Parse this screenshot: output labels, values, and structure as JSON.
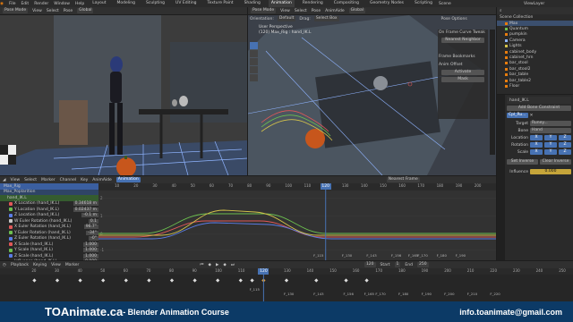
{
  "menu": {
    "items": [
      "File",
      "Edit",
      "Render",
      "Window",
      "Help"
    ],
    "workspaces": [
      "Layout",
      "Modeling",
      "Sculpting",
      "UV Editing",
      "Texture Paint",
      "Shading",
      "Animation",
      "Rendering",
      "Compositing",
      "Geometry Nodes",
      "Scripting"
    ],
    "active_workspace": "Animation",
    "scene": "Scene",
    "view_layer": "ViewLayer"
  },
  "viewport_left": {
    "mode": "Pose Mode",
    "view": "View",
    "select": "Select",
    "pose": "Pose",
    "transform": "Global",
    "orientation_label": "Orientation:",
    "orientation": "Default",
    "drag_label": "Drag:",
    "drag": "Select Box",
    "options": "Pose Options"
  },
  "viewport_right": {
    "mode": "Pose Mode",
    "view": "View",
    "select": "Select",
    "pose": "Pose",
    "animate": "AnimAide",
    "transform": "Global",
    "title": "User Perspective",
    "subtitle": "(120) Max_Rig : hand_IK.L",
    "orientation_label": "Orientation:",
    "orientation": "Default",
    "drag_label": "Drag:",
    "drag": "Select Box",
    "options": "Pose Options",
    "npanel": {
      "frame_curve_tweak": "On Frame Curve Tweak",
      "neighbor": "Nearest Neighbor",
      "frame_bookmarks": "Frame Bookmarks",
      "anim_offset": "Anim Offset",
      "activate": "Activate",
      "mask": "Mask"
    }
  },
  "outliner": {
    "title": "Scene Collection",
    "items": [
      "Max",
      "Quantum",
      "pumpkin",
      "Camera",
      "Lights",
      "cabinet_body",
      "cabinet_hrn",
      "bar_stool",
      "bar_stool2",
      "bar_table",
      "bar_table2",
      "Floor"
    ]
  },
  "properties": {
    "bone": "hand_IK.L",
    "add_constraint": "Add Bone Constraint",
    "constraint": "Cpl_Ru...",
    "target_label": "Target",
    "target": "Runey...",
    "bone_label": "Bone",
    "bone_value": "Hand",
    "fields": [
      {
        "label": "Location",
        "x": "X",
        "y": "Y",
        "z": "Z"
      },
      {
        "label": "Rotation",
        "x": "X",
        "y": "Y",
        "z": "Z"
      },
      {
        "label": "Scale",
        "x": "X",
        "y": "Y",
        "z": "Z"
      }
    ],
    "set_inverse": "Set Inverse",
    "clear_inverse": "Clear Inverse",
    "influence_label": "Influence",
    "influence": "0.000"
  },
  "graph_editor": {
    "header": [
      "View",
      "Select",
      "Marker",
      "Channel",
      "Key",
      "AnimAide"
    ],
    "mode": "Animation",
    "pivot": "Nearest Frame",
    "rig": "Max_Rig",
    "action": "Max_Poplarition",
    "bone": "hand_IK.L",
    "channels": [
      {
        "name": "X Location (hand_IK.L)",
        "value": "0.34618 m",
        "color": "#e05858"
      },
      {
        "name": "Y Location (hand_IK.L)",
        "value": "0.02437 m",
        "color": "#6cbf4f"
      },
      {
        "name": "Z Location (hand_IK.L)",
        "value": "-0.1 m",
        "color": "#5a7de8"
      },
      {
        "name": "W Euler Rotation (hand_IK.L)",
        "value": "0.1",
        "color": "#c8c8c8"
      },
      {
        "name": "X Euler Rotation (hand_IK.L)",
        "value": "96.7°",
        "color": "#e05858"
      },
      {
        "name": "Y Euler Rotation (hand_IK.L)",
        "value": "-34°",
        "color": "#6cbf4f"
      },
      {
        "name": "Z Euler Rotation (hand_IK.L)",
        "value": "-0°",
        "color": "#5a7de8"
      },
      {
        "name": "X Scale (hand_IK.L)",
        "value": "1.000",
        "color": "#e05858"
      },
      {
        "name": "Y Scale (hand_IK.L)",
        "value": "1.000",
        "color": "#6cbf4f"
      },
      {
        "name": "Z Scale (hand_IK.L)",
        "value": "1.000",
        "color": "#5a7de8"
      },
      {
        "name": "Influence (hand_IK.L)",
        "value": "0.000",
        "color": "#c8c8c8"
      }
    ],
    "ticks": [
      "10",
      "20",
      "30",
      "40",
      "50",
      "60",
      "70",
      "80",
      "90",
      "100",
      "110",
      "120",
      "130",
      "140",
      "150",
      "160",
      "170",
      "180",
      "190",
      "200"
    ],
    "current_frame": "120",
    "markers": [
      "F_115",
      "F_130",
      "F_143",
      "F_156",
      "F_165",
      "F_170",
      "F_180",
      "F_190"
    ],
    "y_labels": [
      "2",
      "1",
      "0",
      "-1"
    ]
  },
  "timeline": {
    "header": [
      "Playback",
      "Keying",
      "View",
      "Marker"
    ],
    "start_label": "Start",
    "start": "1",
    "end_label": "End",
    "end": "250",
    "frame": "120",
    "ticks": [
      "20",
      "30",
      "40",
      "50",
      "60",
      "70",
      "80",
      "90",
      "100",
      "110",
      "120",
      "130",
      "140",
      "150",
      "160",
      "170",
      "180",
      "190",
      "200",
      "210",
      "220",
      "230",
      "240",
      "250"
    ],
    "markers": [
      "F_115",
      "F_130",
      "F_143",
      "F_156",
      "F_165",
      "F_170",
      "F_180",
      "F_190",
      "F_200",
      "F_210",
      "F_220"
    ]
  },
  "banner": {
    "brand": "TOAnimate.ca",
    "course": " - Blender Animation Course",
    "email": "info.toanimate@gmail.com"
  }
}
